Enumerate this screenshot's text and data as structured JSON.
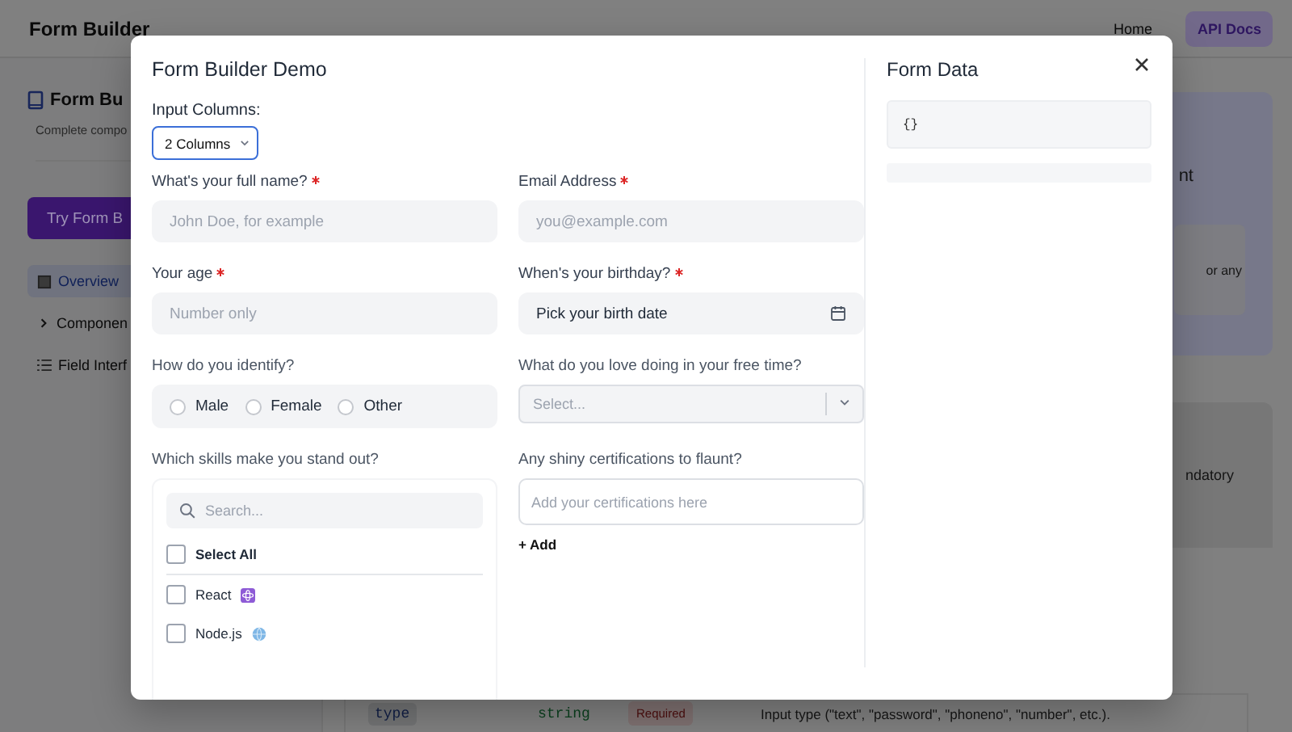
{
  "header": {
    "title": "Form Builder",
    "nav": [
      {
        "label": "Home",
        "selected": false
      },
      {
        "label": "API Docs",
        "selected": true
      }
    ]
  },
  "sidebar": {
    "title": "Form Bu",
    "subtitle": "Complete compo",
    "cta": "Try Form B",
    "items": [
      {
        "kind": "page",
        "label": "Overview",
        "selected": true
      },
      {
        "kind": "group",
        "label": "Componen",
        "selected": false
      },
      {
        "kind": "list",
        "label": "Field Interf",
        "selected": false
      }
    ]
  },
  "content": {
    "fragments": [
      "nt",
      "or any",
      "ndatory"
    ],
    "table_row": {
      "name": "type",
      "type": "string",
      "badge": "Required",
      "description": "Input type (\"text\", \"password\", \"phoneno\", \"number\", etc.)."
    }
  },
  "modal": {
    "title": "Form Builder Demo",
    "columns_label": "Input Columns:",
    "columns_value": "2 Columns",
    "fields": [
      {
        "kind": "text",
        "label": "What's your full name?",
        "required": true,
        "placeholder": "John Doe, for example"
      },
      {
        "kind": "text",
        "label": "Email Address",
        "required": true,
        "placeholder": "you@example.com"
      },
      {
        "kind": "text",
        "label": "Your age",
        "required": true,
        "placeholder": "Number only"
      },
      {
        "kind": "date",
        "label": "When's your birthday?",
        "required": true,
        "placeholder": "Pick your birth date"
      },
      {
        "kind": "radio",
        "label": "How do you identify?",
        "required": false,
        "options": [
          {
            "label": "Male",
            "selected": false
          },
          {
            "label": "Female",
            "selected": false
          },
          {
            "label": "Other",
            "selected": false
          }
        ]
      },
      {
        "kind": "select",
        "label": "What do you love doing in your free time?",
        "required": false,
        "placeholder": "Select..."
      },
      {
        "kind": "checklist",
        "label": "Which skills make you stand out?",
        "required": false,
        "search_placeholder": "Search...",
        "select_all": {
          "label": "Select All",
          "checked": false
        },
        "options": [
          {
            "label": "React",
            "checked": false
          },
          {
            "label": "Node.js",
            "checked": false
          }
        ]
      },
      {
        "kind": "tags",
        "label": "Any shiny certifications to flaunt?",
        "required": false,
        "placeholder": "Add your certifications here",
        "add_label": "+ Add"
      }
    ],
    "data_title": "Form Data",
    "data_json": "{}"
  }
}
